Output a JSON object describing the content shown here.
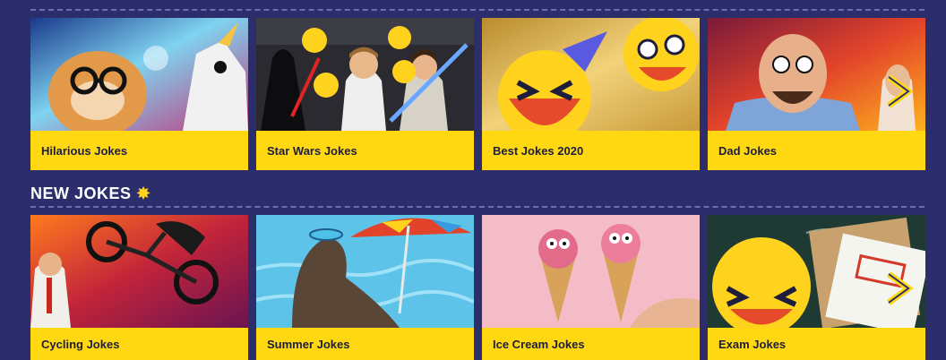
{
  "sections": [
    {
      "title": "",
      "cards": [
        {
          "label": "Hilarious Jokes",
          "image": "cat-and-unicorn-image"
        },
        {
          "label": "Star Wars Jokes",
          "image": "star-wars-characters-image"
        },
        {
          "label": "Best Jokes 2020",
          "image": "laughing-emoji-party-image"
        },
        {
          "label": "Dad Jokes",
          "image": "laughing-dad-image"
        }
      ]
    },
    {
      "title": "NEW JOKES",
      "title_icon": "sparkle-star-icon",
      "cards": [
        {
          "label": "Cycling Jokes",
          "image": "bmx-bike-rider-image"
        },
        {
          "label": "Summer Jokes",
          "image": "sea-lion-beach-umbrella-image"
        },
        {
          "label": "Ice Cream Jokes",
          "image": "ice-cream-cones-image"
        },
        {
          "label": "Exam Jokes",
          "image": "laughing-emoji-notebook-image"
        }
      ]
    }
  ],
  "colors": {
    "background": "#2b2e6b",
    "card_label_bg": "#ffd812",
    "card_label_text": "#1e1e3c",
    "heading_text": "#ffffff"
  }
}
